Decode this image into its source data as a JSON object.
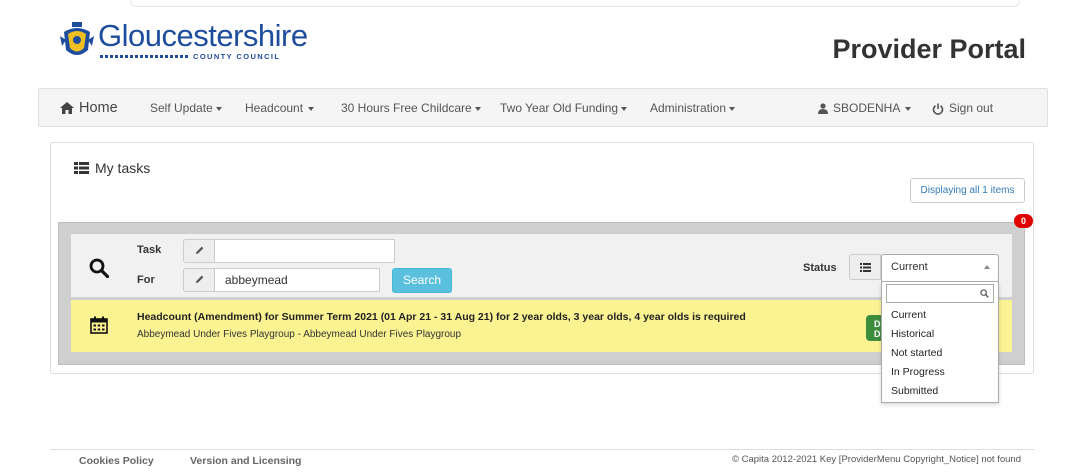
{
  "header": {
    "logo_main": "Gloucestershire",
    "logo_sub": "COUNTY COUNCIL",
    "portal_title": "Provider Portal"
  },
  "nav": {
    "home": "Home",
    "items": [
      {
        "label": "Self Update"
      },
      {
        "label": "Headcount"
      },
      {
        "label": "30 Hours Free Childcare"
      },
      {
        "label": "Two Year Old Funding"
      },
      {
        "label": "Administration"
      }
    ],
    "user": "SBODENHA",
    "sign_out": "Sign out"
  },
  "tasks": {
    "title": "My tasks",
    "display_count": "Displaying all 1 items",
    "badge_count": "0",
    "filter": {
      "task_label": "Task",
      "task_value": "",
      "for_label": "For",
      "for_value": "abbeymead",
      "search_button": "Search",
      "status_label": "Status",
      "status_selected": "Current",
      "dropdown_search_value": "",
      "status_options": [
        "Current",
        "Historical",
        "Not started",
        "In Progress",
        "Submitted"
      ]
    },
    "rows": [
      {
        "title": "Headcount (Amendment) for Summer Term 2021 (01 Apr 21 - 31 Aug 21) for 2 year olds, 3 year olds, 4 year olds is required",
        "subtitle": "Abbeymead Under Fives Playgroup - Abbeymead Under Fives Playgroup",
        "action_line1": "D",
        "action_line2": "D"
      }
    ]
  },
  "footer": {
    "cookies": "Cookies Policy",
    "version": "Version and Licensing",
    "copyright": "© Capita 2012-2021 Key [ProviderMenu Copyright_Notice] not found"
  },
  "colors": {
    "brand_blue": "#1f4d9e",
    "task_highlight": "#fbf392",
    "search_button": "#5bc0de",
    "badge": "#e00000",
    "action_green": "#3c8d3c"
  }
}
